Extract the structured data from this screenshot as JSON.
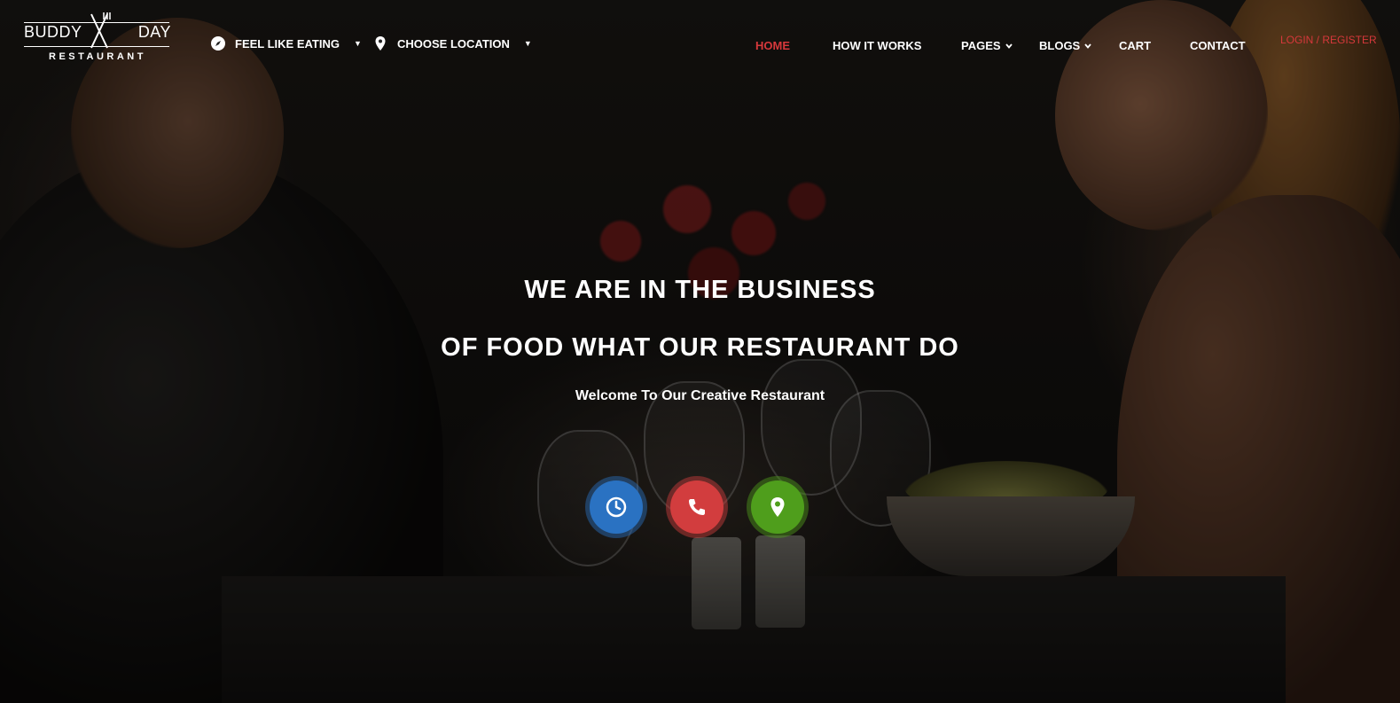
{
  "logo": {
    "left_word": "BUDDY",
    "right_word": "DAY",
    "subtitle": "RESTAURANT"
  },
  "pickers": [
    {
      "label": "FEEL LIKE EATING",
      "icon": "compass-icon"
    },
    {
      "label": "CHOOSE LOCATION",
      "icon": "map-pin-icon"
    }
  ],
  "nav": {
    "items": [
      {
        "label": "HOME",
        "active": true
      },
      {
        "label": "HOW IT WORKS"
      },
      {
        "label": "PAGES",
        "dropdown": true
      },
      {
        "label": "BLOGS",
        "dropdown": true
      },
      {
        "label": "CART"
      },
      {
        "label": "CONTACT"
      }
    ],
    "login_label": "LOGIN / REGISTER"
  },
  "hero": {
    "headline_line1": "WE ARE IN THE BUSINESS",
    "headline_line2": "OF FOOD WHAT OUR RESTAURANT DO",
    "tagline": "Welcome To Our Creative Restaurant",
    "action_icons": [
      {
        "icon": "clock-icon",
        "color": "#2a72c2"
      },
      {
        "icon": "phone-icon",
        "color": "#d23d3e"
      },
      {
        "icon": "location-pin-icon",
        "color": "#4f9e1c"
      }
    ]
  },
  "colors": {
    "accent": "#d6383b",
    "text": "#ffffff"
  }
}
